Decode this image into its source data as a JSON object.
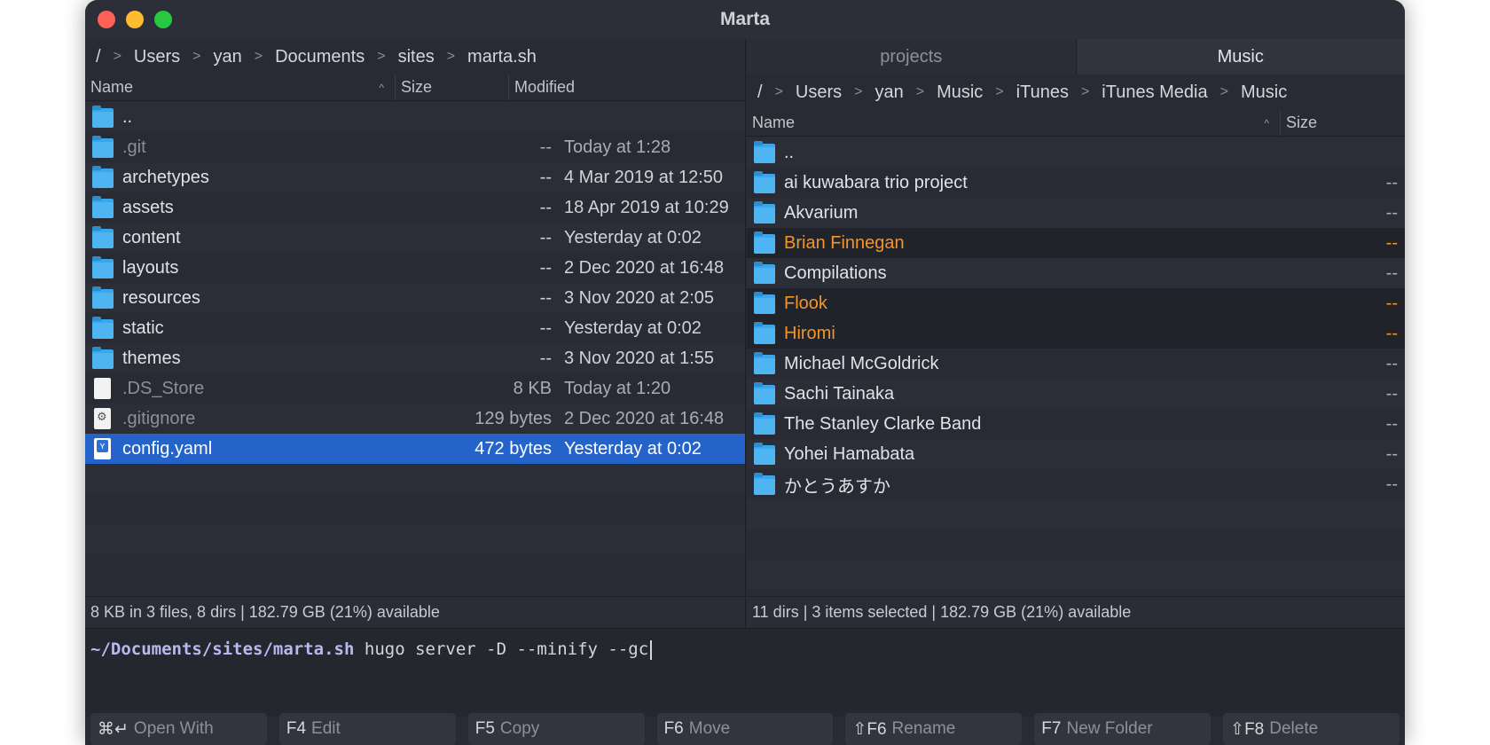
{
  "window": {
    "title": "Marta"
  },
  "left": {
    "path": [
      "/",
      "Users",
      "yan",
      "Documents",
      "sites",
      "marta.sh"
    ],
    "columns": {
      "name": "Name",
      "size": "Size",
      "modified": "Modified"
    },
    "items": [
      {
        "name": "..",
        "size": "",
        "modified": "",
        "kind": "folder",
        "dim": false,
        "selected": false
      },
      {
        "name": ".git",
        "size": "--",
        "modified": "Today at 1:28",
        "kind": "folder",
        "dim": true,
        "selected": false
      },
      {
        "name": "archetypes",
        "size": "--",
        "modified": "4 Mar 2019 at 12:50",
        "kind": "folder",
        "dim": false,
        "selected": false
      },
      {
        "name": "assets",
        "size": "--",
        "modified": "18 Apr 2019 at 10:29",
        "kind": "folder",
        "dim": false,
        "selected": false
      },
      {
        "name": "content",
        "size": "--",
        "modified": "Yesterday at 0:02",
        "kind": "folder",
        "dim": false,
        "selected": false
      },
      {
        "name": "layouts",
        "size": "--",
        "modified": "2 Dec 2020 at 16:48",
        "kind": "folder",
        "dim": false,
        "selected": false
      },
      {
        "name": "resources",
        "size": "--",
        "modified": "3 Nov 2020 at 2:05",
        "kind": "folder",
        "dim": false,
        "selected": false
      },
      {
        "name": "static",
        "size": "--",
        "modified": "Yesterday at 0:02",
        "kind": "folder",
        "dim": false,
        "selected": false
      },
      {
        "name": "themes",
        "size": "--",
        "modified": "3 Nov 2020 at 1:55",
        "kind": "folder",
        "dim": false,
        "selected": false
      },
      {
        "name": ".DS_Store",
        "size": "8 KB",
        "modified": "Today at 1:20",
        "kind": "file",
        "dim": true,
        "selected": false
      },
      {
        "name": ".gitignore",
        "size": "129 bytes",
        "modified": "2 Dec 2020 at 16:48",
        "kind": "file-gear",
        "dim": true,
        "selected": false
      },
      {
        "name": "config.yaml",
        "size": "472 bytes",
        "modified": "Yesterday at 0:02",
        "kind": "file-yaml",
        "dim": false,
        "selected": true
      }
    ],
    "status": "8 KB in 3 files, 8 dirs  |  182.79 GB (21%) available"
  },
  "right": {
    "tabs": [
      {
        "label": "projects",
        "active": false
      },
      {
        "label": "Music",
        "active": true
      }
    ],
    "path": [
      "/",
      "Users",
      "yan",
      "Music",
      "iTunes",
      "iTunes Media",
      "Music"
    ],
    "columns": {
      "name": "Name",
      "size": "Size"
    },
    "items": [
      {
        "name": "..",
        "size": "",
        "marked": false
      },
      {
        "name": "ai kuwabara trio project",
        "size": "--",
        "marked": false
      },
      {
        "name": "Akvarium",
        "size": "--",
        "marked": false
      },
      {
        "name": "Brian Finnegan",
        "size": "--",
        "marked": true
      },
      {
        "name": "Compilations",
        "size": "--",
        "marked": false
      },
      {
        "name": "Flook",
        "size": "--",
        "marked": true
      },
      {
        "name": "Hiromi",
        "size": "--",
        "marked": true
      },
      {
        "name": "Michael McGoldrick",
        "size": "--",
        "marked": false
      },
      {
        "name": "Sachi Tainaka",
        "size": "--",
        "marked": false
      },
      {
        "name": "The Stanley Clarke Band",
        "size": "--",
        "marked": false
      },
      {
        "name": "Yohei Hamabata",
        "size": "--",
        "marked": false
      },
      {
        "name": "かとうあすか",
        "size": "--",
        "marked": false
      }
    ],
    "status": "11 dirs  |  3 items selected  |  182.79 GB (21%) available"
  },
  "console": {
    "prompt": "~/Documents/sites/marta.sh",
    "command": "hugo server -D --minify --gc"
  },
  "fkeys": [
    {
      "key": "⌘↵",
      "label": "Open With"
    },
    {
      "key": "F4",
      "label": "Edit"
    },
    {
      "key": "F5",
      "label": "Copy"
    },
    {
      "key": "F6",
      "label": "Move"
    },
    {
      "key": "⇧F6",
      "label": "Rename"
    },
    {
      "key": "F7",
      "label": "New Folder"
    },
    {
      "key": "⇧F8",
      "label": "Delete"
    }
  ],
  "colors": {
    "selection": "#2463c9",
    "marked": "#f39528",
    "folder": "#3aa7ec"
  }
}
